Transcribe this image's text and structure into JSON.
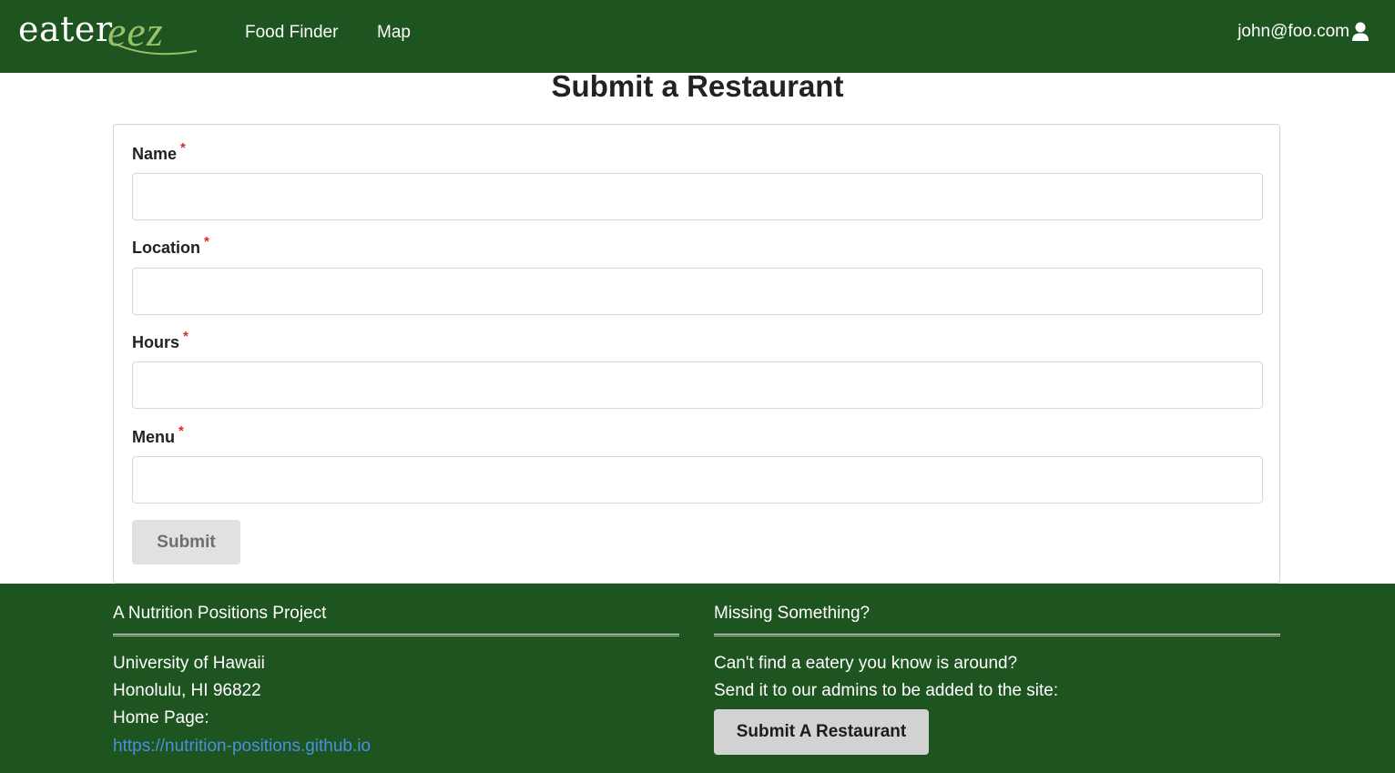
{
  "brand": {
    "logo_text_primary": "eater",
    "logo_text_accent": "eez",
    "colors": {
      "nav_bg": "#1e5420",
      "accent": "#9bc06a",
      "link": "#4a90e2",
      "required": "#db2828"
    }
  },
  "nav": {
    "items": [
      {
        "label": "Food Finder"
      },
      {
        "label": "Map"
      }
    ],
    "user_email": "john@foo.com",
    "user_icon": "user-icon"
  },
  "main": {
    "title": "Submit a Restaurant",
    "fields": [
      {
        "label": "Name",
        "required_mark": "*",
        "value": ""
      },
      {
        "label": "Location",
        "required_mark": "*",
        "value": ""
      },
      {
        "label": "Hours",
        "required_mark": "*",
        "value": ""
      },
      {
        "label": "Menu",
        "required_mark": "*",
        "value": ""
      }
    ],
    "submit_label": "Submit"
  },
  "footer": {
    "left": {
      "heading": "A Nutrition Positions Project",
      "lines": [
        "University of Hawaii",
        "Honolulu, HI 96822",
        "Home Page:"
      ],
      "link": "https://nutrition-positions.github.io"
    },
    "right": {
      "heading": "Missing Something?",
      "lines": [
        "Can't find a eatery you know is around?",
        "Send it to our admins to be added to the site:"
      ],
      "button_label": "Submit A Restaurant"
    }
  }
}
